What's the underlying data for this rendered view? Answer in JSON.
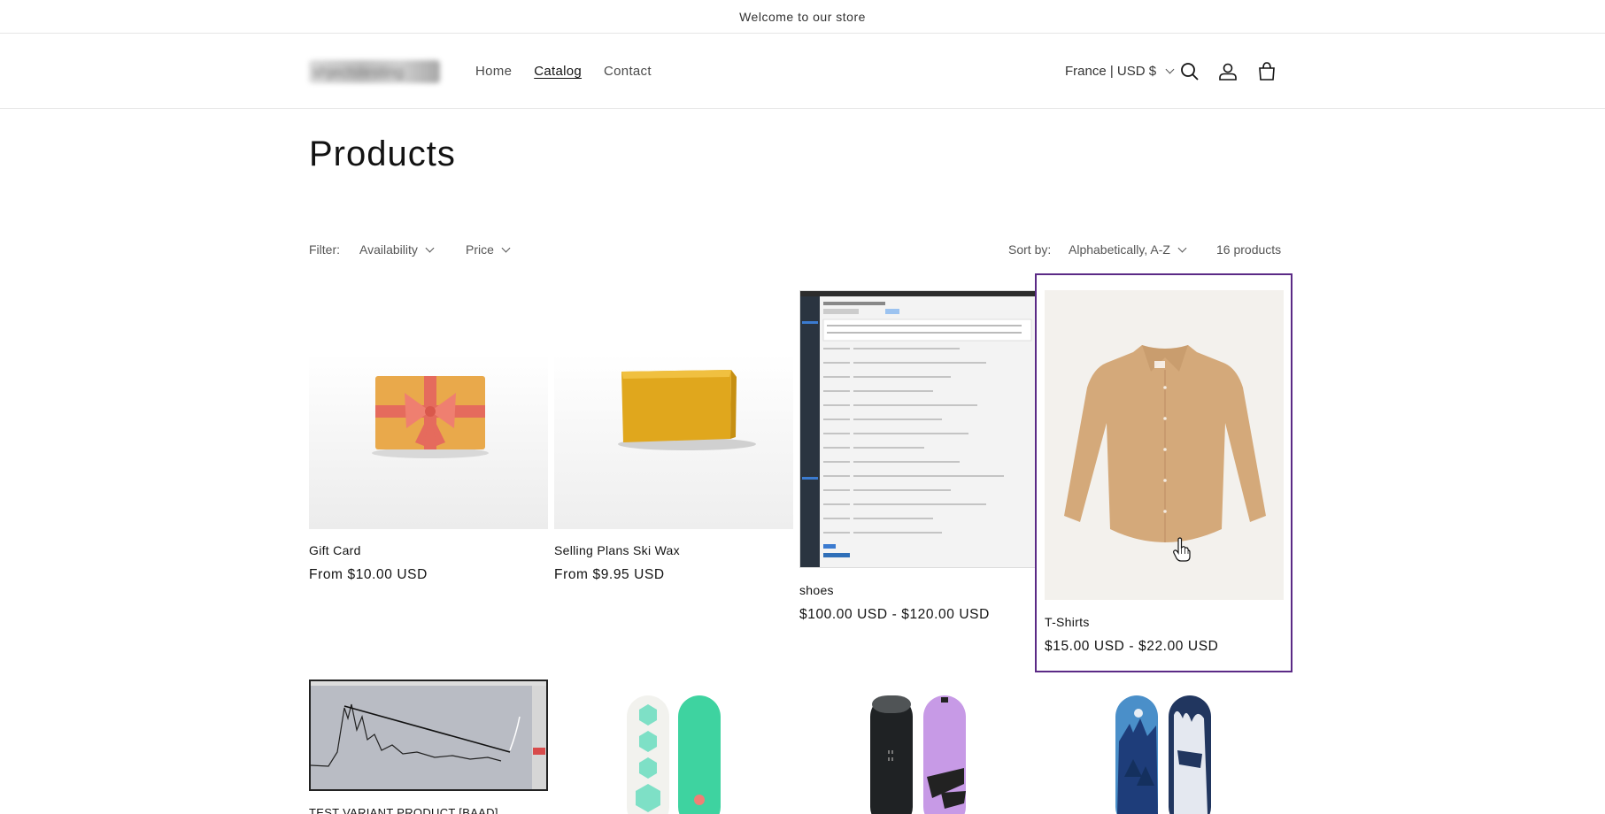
{
  "announcement": "Welcome to our store",
  "header": {
    "logo_text": "shjectstesting",
    "nav": [
      "Home",
      "Catalog",
      "Contact"
    ],
    "locale": "France | USD $",
    "icons": [
      "search-icon",
      "account-icon",
      "cart-icon"
    ]
  },
  "page_title": "Products",
  "filters": {
    "label": "Filter:",
    "availability": "Availability",
    "price": "Price",
    "sort_label": "Sort by:",
    "sort_value": "Alphabetically, A-Z",
    "count": "16 products"
  },
  "products": [
    {
      "title": "Gift Card",
      "price": "From $10.00 USD"
    },
    {
      "title": "Selling Plans Ski Wax",
      "price": "From $9.95 USD"
    },
    {
      "title": "shoes",
      "price": "$100.00 USD - $120.00 USD"
    },
    {
      "title": "T-Shirts",
      "price": "$15.00 USD - $22.00 USD"
    },
    {
      "title": "TEST VARIANT PRODUCT [BAAD]",
      "price": ""
    },
    {
      "title": "",
      "price": ""
    },
    {
      "title": "",
      "price": ""
    },
    {
      "title": "",
      "price": ""
    }
  ],
  "colors": {
    "selection_border": "#5b2a86",
    "text": "#121212"
  }
}
